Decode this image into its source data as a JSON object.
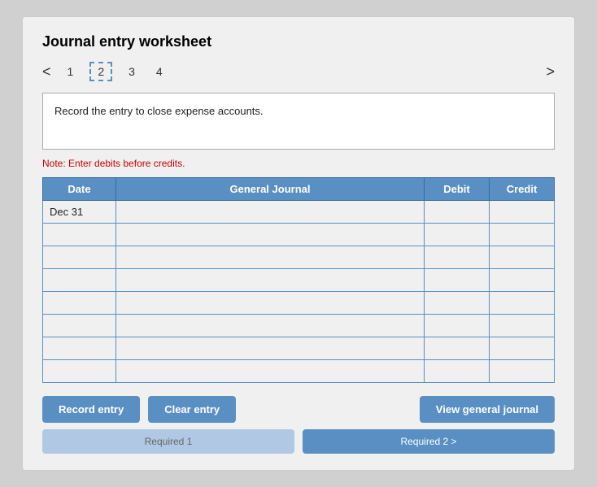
{
  "title": "Journal entry worksheet",
  "tabs": [
    {
      "label": "1",
      "active": false
    },
    {
      "label": "2",
      "active": true
    },
    {
      "label": "3",
      "active": false
    },
    {
      "label": "4",
      "active": false
    }
  ],
  "nav": {
    "prev": "<",
    "next": ">"
  },
  "instruction": "Record the entry to close expense accounts.",
  "note": "Note: Enter debits before credits.",
  "table": {
    "headers": {
      "date": "Date",
      "journal": "General Journal",
      "debit": "Debit",
      "credit": "Credit"
    },
    "rows": [
      {
        "date": "Dec 31",
        "journal": "",
        "debit": "",
        "credit": ""
      },
      {
        "date": "",
        "journal": "",
        "debit": "",
        "credit": ""
      },
      {
        "date": "",
        "journal": "",
        "debit": "",
        "credit": ""
      },
      {
        "date": "",
        "journal": "",
        "debit": "",
        "credit": ""
      },
      {
        "date": "",
        "journal": "",
        "debit": "",
        "credit": ""
      },
      {
        "date": "",
        "journal": "",
        "debit": "",
        "credit": ""
      },
      {
        "date": "",
        "journal": "",
        "debit": "",
        "credit": ""
      },
      {
        "date": "",
        "journal": "",
        "debit": "",
        "credit": ""
      }
    ]
  },
  "buttons": {
    "record_entry": "Record entry",
    "clear_entry": "Clear entry",
    "view_journal": "View general journal"
  },
  "bottom_buttons": {
    "required1": "Required 1",
    "required2": "Required 2 >"
  }
}
